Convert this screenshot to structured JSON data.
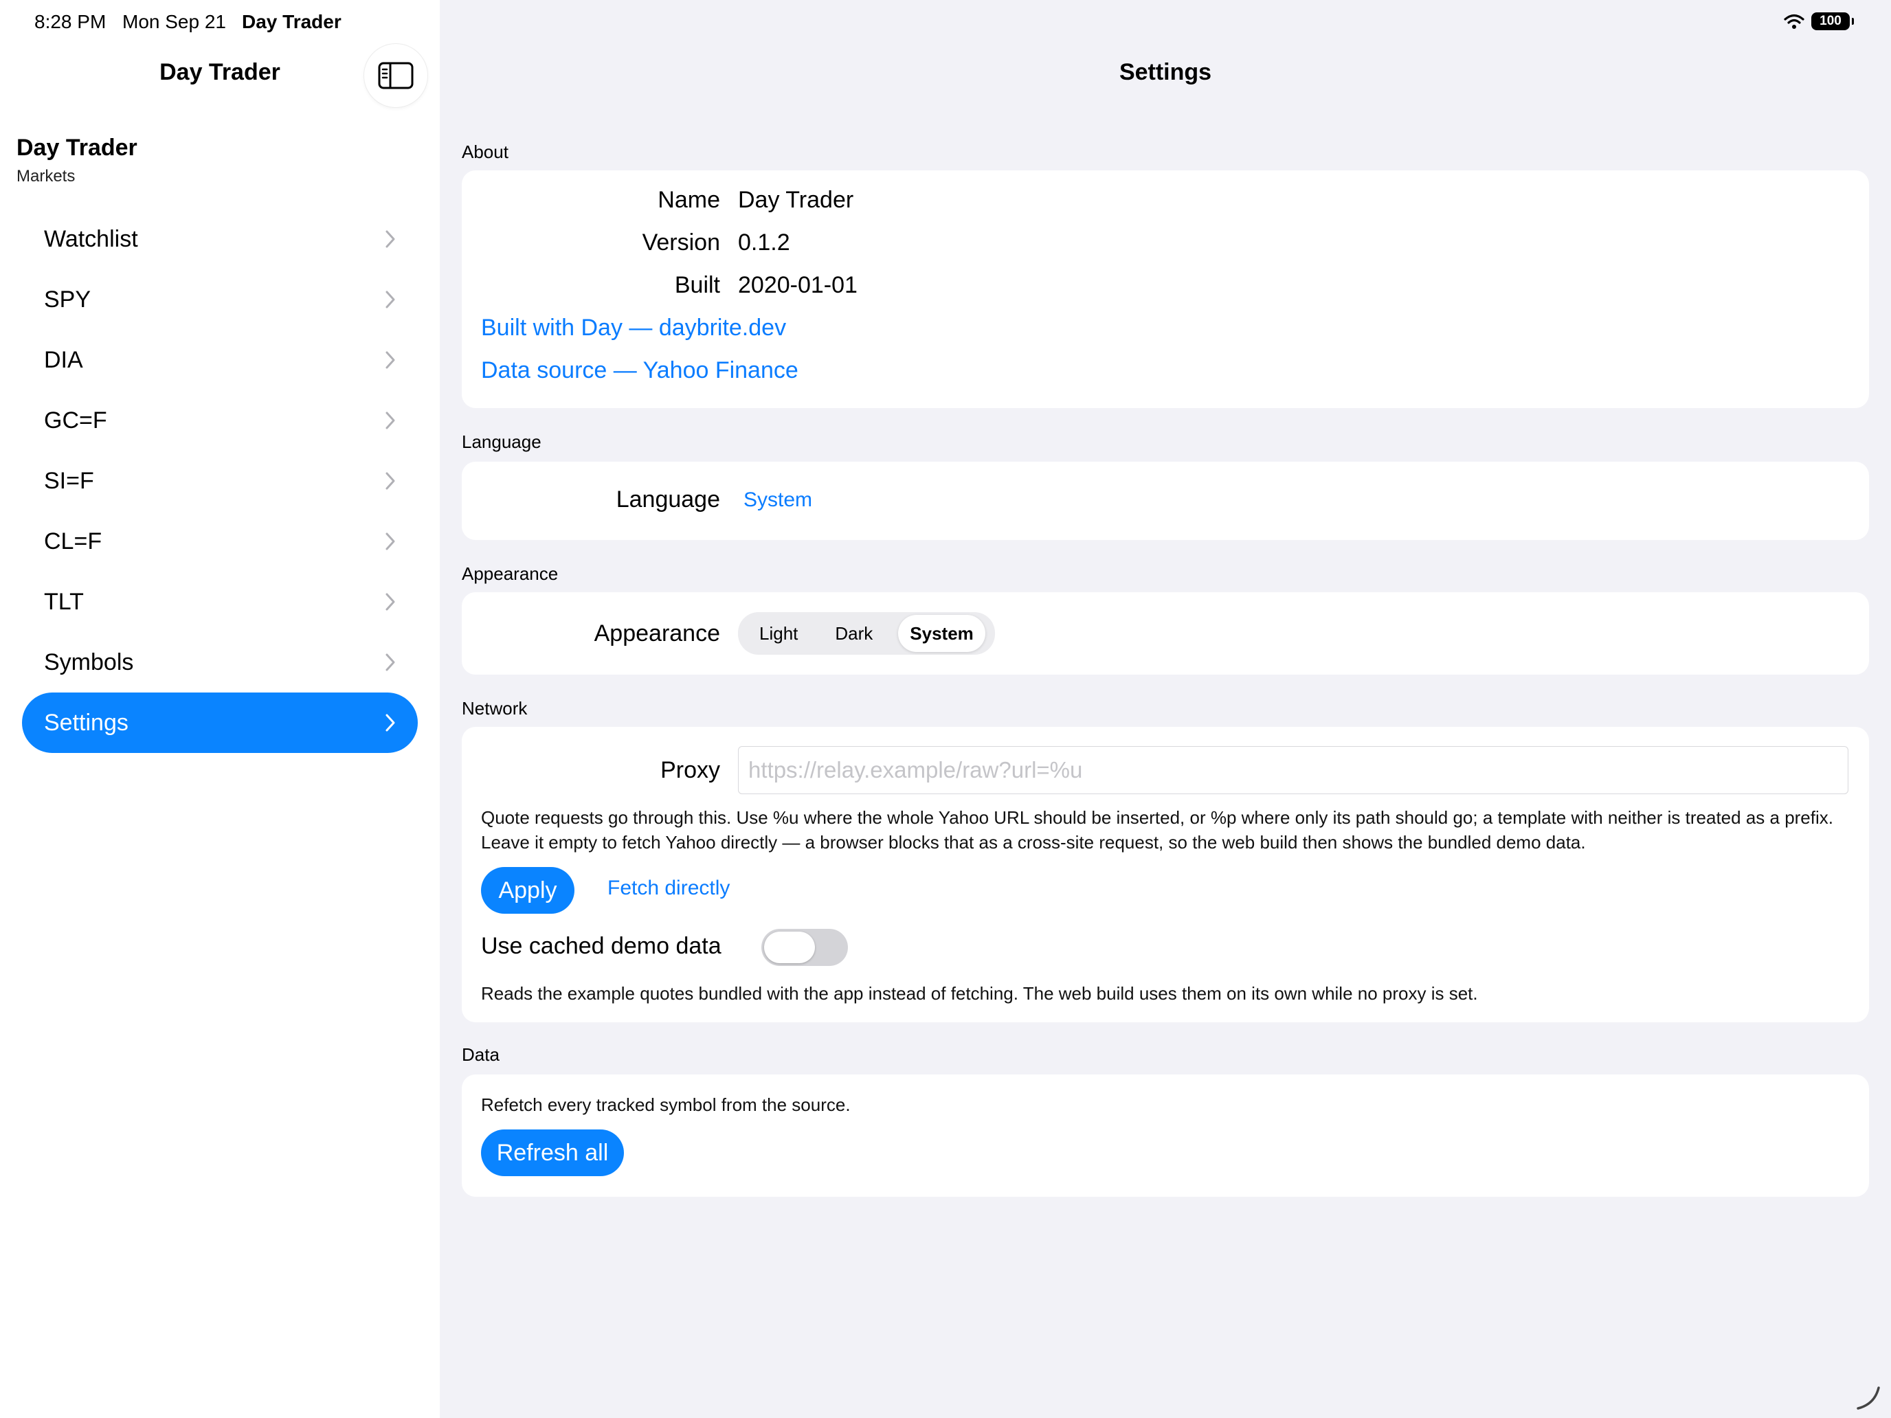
{
  "status_bar": {
    "time": "8:28 PM",
    "date": "Mon Sep 21",
    "app": "Day Trader",
    "battery": "100"
  },
  "sidebar": {
    "title": "Day Trader",
    "toggle_icon": "sidebar-toggle-icon",
    "section_title": "Day Trader",
    "section_subtitle": "Markets",
    "items": [
      {
        "label": "Watchlist",
        "selected": false
      },
      {
        "label": "SPY",
        "selected": false
      },
      {
        "label": "DIA",
        "selected": false
      },
      {
        "label": "GC=F",
        "selected": false
      },
      {
        "label": "SI=F",
        "selected": false
      },
      {
        "label": "CL=F",
        "selected": false
      },
      {
        "label": "TLT",
        "selected": false
      },
      {
        "label": "Symbols",
        "selected": false
      },
      {
        "label": "Settings",
        "selected": true
      }
    ]
  },
  "main": {
    "title": "Settings",
    "about": {
      "section_label": "About",
      "name_label": "Name",
      "name_value": "Day Trader",
      "version_label": "Version",
      "version_value": "0.1.2",
      "built_label": "Built",
      "built_value": "2020-01-01",
      "link_built_with": "Built with Day — daybrite.dev",
      "link_data_source": "Data source — Yahoo Finance"
    },
    "language": {
      "section_label": "Language",
      "label": "Language",
      "value": "System"
    },
    "appearance": {
      "section_label": "Appearance",
      "label": "Appearance",
      "options": [
        "Light",
        "Dark",
        "System"
      ],
      "selected": "System"
    },
    "network": {
      "section_label": "Network",
      "proxy_label": "Proxy",
      "proxy_value": "",
      "proxy_placeholder": "https://relay.example/raw?url=%u",
      "help_text": "Quote requests go through this. Use %u where the whole Yahoo URL should be inserted, or %p where only its path should go; a template with neither is treated as a prefix. Leave it empty to fetch Yahoo directly — a browser blocks that as a cross-site request, so the web build then shows the bundled demo data.",
      "apply_label": "Apply",
      "fetch_directly_label": "Fetch directly",
      "cached_label": "Use cached demo data",
      "cached_enabled": false,
      "cached_help": "Reads the example quotes bundled with the app instead of fetching. The web build uses them on its own while no proxy is set."
    },
    "data": {
      "section_label": "Data",
      "description": "Refetch every tracked symbol from the source.",
      "refresh_label": "Refresh all"
    }
  },
  "colors": {
    "accent": "#0a84ff",
    "link": "#0a7cff",
    "background": "#f2f2f7",
    "card": "#ffffff"
  }
}
